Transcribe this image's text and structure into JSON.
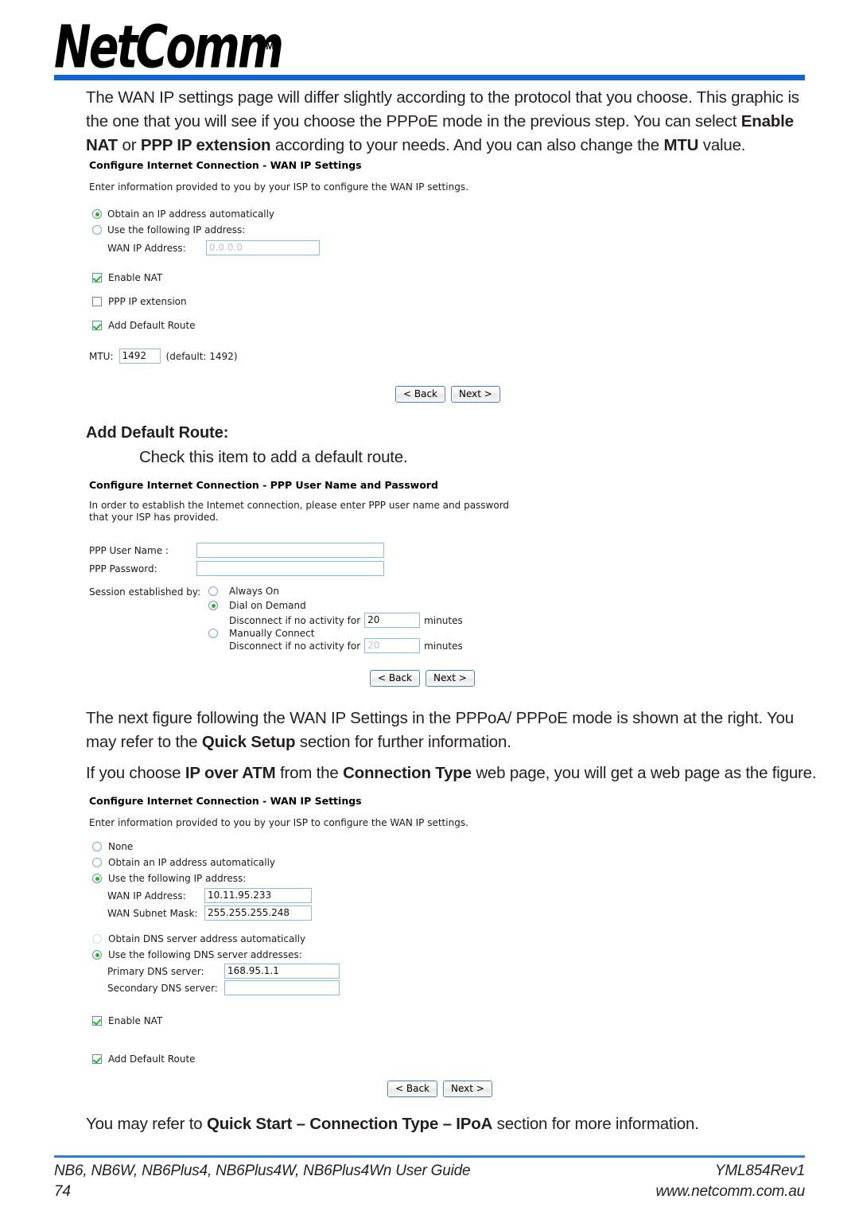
{
  "header": {
    "logo_text": "NetComm",
    "logo_tm": "TM"
  },
  "intro_paragraph": {
    "part1": "The WAN IP settings page will differ slightly according to the protocol that you choose. This graphic is the one that you will see if you choose the PPPoE mode in the previous step. You can select ",
    "bold1": "Enable NAT",
    "part2": " or ",
    "bold2": "PPP IP extension",
    "part3": " according to your needs. And you can also change the ",
    "bold3": "MTU",
    "part4": " value."
  },
  "form_wan_pppoe": {
    "title": "Configure Internet Connection - WAN IP Settings",
    "description": "Enter information provided to you by your ISP to configure the WAN IP settings.",
    "radios": [
      {
        "label": "Obtain an IP address automatically",
        "selected": true
      },
      {
        "label": "Use the following IP address:",
        "selected": false
      }
    ],
    "wan_ip_label": "WAN IP Address:",
    "wan_ip_value": "0.0.0.0",
    "checkboxes": [
      {
        "label": "Enable NAT",
        "checked": true
      },
      {
        "label": "PPP IP extension",
        "checked": false
      },
      {
        "label": "Add Default Route",
        "checked": true
      }
    ],
    "mtu_label": "MTU:",
    "mtu_value": "1492",
    "mtu_default": "(default: 1492)",
    "back_button": "< Back",
    "next_button": "Next >"
  },
  "section_add_default_route": {
    "heading": "Add Default Route:",
    "body": "Check this item to add a default route."
  },
  "form_ppp_credentials": {
    "title": "Configure Internet Connection - PPP User Name and Password",
    "description_line1": "In order to establish the Intemet connection, please enter PPP user name and password",
    "description_line2": "that your ISP has provided.",
    "user_name_label": "PPP User Name :",
    "user_name_value": "",
    "password_label": "PPP Password:",
    "password_value": "",
    "session_label": "Session established by:",
    "session_options": [
      {
        "label": "Always On",
        "selected": false
      },
      {
        "label": "Dial on Demand",
        "selected": true
      },
      {
        "label": "Manually Connect",
        "selected": false
      }
    ],
    "disconnect_label": "Disconnect if no activity for",
    "disconnect_value_1": "20",
    "disconnect_value_2": "20",
    "minutes_label": "minutes",
    "back_button": "< Back",
    "next_button": "Next >"
  },
  "middle_paragraph": {
    "part1": "The next figure following the WAN IP Settings in the PPPoA/ PPPoE mode is shown at the right. You may refer to the ",
    "bold1": "Quick Setup",
    "part2": " section for further information."
  },
  "ipoa_paragraph": {
    "part1": "If you choose ",
    "bold1": "IP over ATM",
    "part2": " from the ",
    "bold2": "Connection Type",
    "part3": " web page, you will get a web page as the figure."
  },
  "form_wan_ipoa": {
    "title": "Configure Internet Connection - WAN IP Settings",
    "description": "Enter information provided to you by your ISP to configure the WAN IP settings.",
    "ip_radios": [
      {
        "label": "None",
        "selected": false
      },
      {
        "label": "Obtain an IP address automatically",
        "selected": false
      },
      {
        "label": "Use the following IP address:",
        "selected": true
      }
    ],
    "wan_ip_label": "WAN IP Address:",
    "wan_ip_value": "10.11.95.233",
    "wan_mask_label": "WAN Subnet Mask:",
    "wan_mask_value": "255.255.255.248",
    "dns_radios": [
      {
        "label": "Obtain DNS server address automatically",
        "selected": false
      },
      {
        "label": "Use the following DNS server addresses:",
        "selected": true
      }
    ],
    "primary_dns_label": "Primary DNS server:",
    "primary_dns_value": "168.95.1.1",
    "secondary_dns_label": "Secondary DNS server:",
    "secondary_dns_value": "",
    "checkboxes": [
      {
        "label": "Enable NAT",
        "checked": true
      },
      {
        "label": "Add Default Route",
        "checked": true
      }
    ],
    "back_button": "< Back",
    "next_button": "Next >"
  },
  "closing_paragraph": {
    "part1": "You may refer to ",
    "bold1": "Quick Start – Connection Type – IPoA",
    "part2": " section for more information."
  },
  "footer": {
    "guide": "NB6, NB6W, NB6Plus4, NB6Plus4W, NB6Plus4Wn User Guide",
    "page_number": "74",
    "revision": "YML854Rev1",
    "website": "www.netcomm.com.au"
  },
  "colors": {
    "header_rule": "#1263d2",
    "footer_rule": "#2f7ed8",
    "check_green": "#21b521",
    "input_border": "#8fbcdd"
  }
}
